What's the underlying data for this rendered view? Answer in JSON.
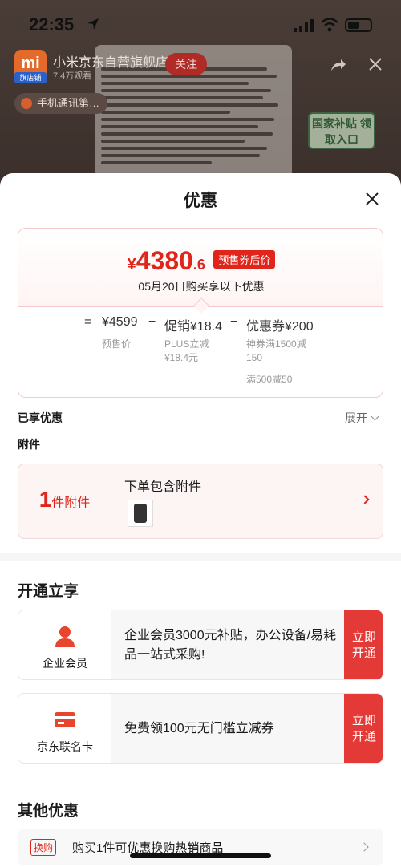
{
  "status_bar": {
    "time": "22:35"
  },
  "background": {
    "store_logo": "mi",
    "store_badge": "旗店铺",
    "store_name": "小米京东自营旗舰店",
    "followers": "7.4万观看",
    "follow_label": "关注",
    "tag_chip": "手机通讯第…",
    "subsidy_banner": "国家补贴 领取入口"
  },
  "sheet": {
    "title": "优惠",
    "price": {
      "yen": "¥",
      "integer": "4380",
      "decimal": ".6",
      "tag": "预售券后价",
      "date_text": "05月20日购买享以下优惠"
    },
    "formula": {
      "eq": "=",
      "base": "¥4599",
      "base_label": "预售价",
      "minus1": "−",
      "promo": "促销¥18.4",
      "promo_label1": "PLUS立减",
      "promo_label2": "¥18.4元",
      "minus2": "−",
      "coupon": "优惠券¥200",
      "coupon_label1": "神券满1500减",
      "coupon_label2": "150",
      "coupon_label3": "满500减50"
    },
    "enjoyed_label": "已享优惠",
    "expand_label": "展开",
    "accessory_label": "附件",
    "accessory_card": {
      "count": "1",
      "unit": "件附件",
      "title": "下单包含附件"
    },
    "open_title": "开通立享",
    "members": [
      {
        "name": "企业会员",
        "desc": "企业会员3000元补贴，办公设备/易耗品一站式采购!",
        "button": "立即开通",
        "icon": "person-icon"
      },
      {
        "name": "京东联名卡",
        "desc": "免费领100元无门槛立减券",
        "button": "立即开通",
        "icon": "card-icon"
      }
    ],
    "other_title": "其他优惠",
    "swap": {
      "tag": "换购",
      "text": "购买1件可优惠换购热销商品"
    }
  },
  "colors": {
    "accent": "#e1251b",
    "button": "#e43a37"
  }
}
